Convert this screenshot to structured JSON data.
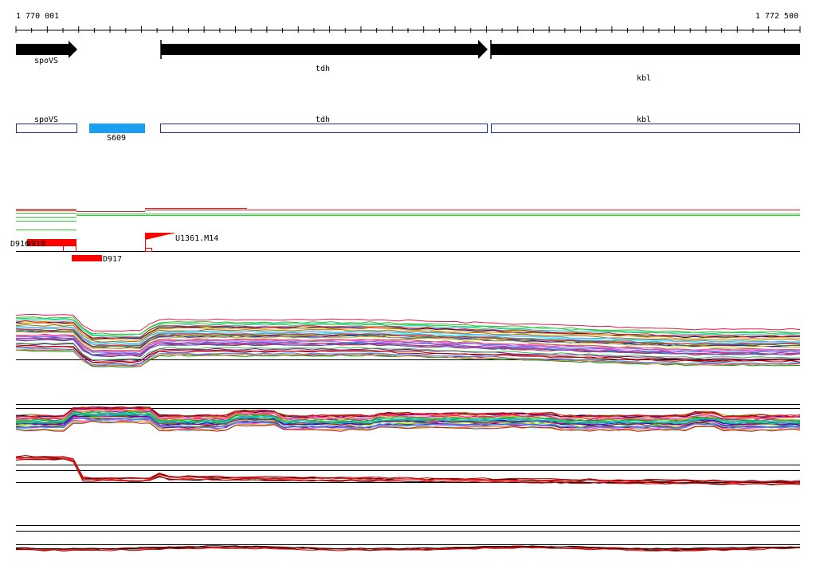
{
  "coordinates": {
    "start": "1 770 001",
    "end": "1 772 500"
  },
  "genes": [
    {
      "name": "spoVS",
      "strand": "+"
    },
    {
      "name": "tdh",
      "strand": "+"
    },
    {
      "name": "kbl",
      "strand": "+"
    }
  ],
  "annotations": [
    {
      "name": "spoVS",
      "kind": "outline"
    },
    {
      "name": "S609",
      "kind": "filled"
    },
    {
      "name": "tdh",
      "kind": "outline"
    },
    {
      "name": "kbl",
      "kind": "outline"
    }
  ],
  "transcripts": [
    {
      "name": "D916"
    },
    {
      "name": "D918"
    },
    {
      "name": "D917"
    },
    {
      "name": "U1361.M14"
    }
  ],
  "colors": {
    "gene": "#000000",
    "annotation_outline": "#1c2a9a",
    "annotation_filled": "#1a9ff0",
    "transcript": "#ff0000",
    "track_red": "#e11919",
    "track_green": "#2ecc2e"
  }
}
